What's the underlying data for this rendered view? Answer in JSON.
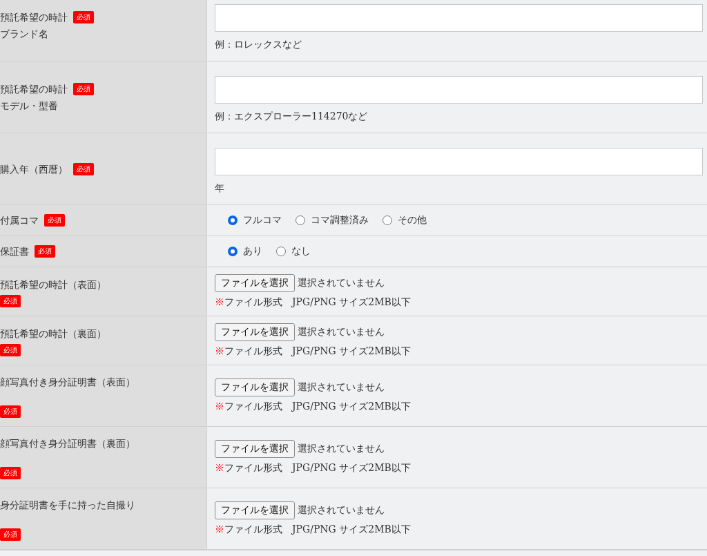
{
  "rows": [
    {
      "kind": "text",
      "label_lines": [
        "預託希望の時計",
        "ブランド名"
      ],
      "badge": "必須",
      "value": "",
      "hint": "例：ロレックスなど"
    },
    {
      "kind": "text",
      "label_lines": [
        "預託希望の時計",
        "モデル・型番"
      ],
      "badge": "必須",
      "value": "",
      "hint": "例：エクスプローラー114270など"
    },
    {
      "kind": "text",
      "label_lines": [
        "購入年（西暦）"
      ],
      "badge": "必須",
      "value": "",
      "hint": "年"
    },
    {
      "kind": "radio",
      "label_lines": [
        "付属コマ"
      ],
      "badge": "必須",
      "options": [
        {
          "label": "フルコマ",
          "selected": true
        },
        {
          "label": "コマ調整済み",
          "selected": false
        },
        {
          "label": "その他",
          "selected": false
        }
      ]
    },
    {
      "kind": "radio",
      "label_lines": [
        "保証書"
      ],
      "badge": "必須",
      "options": [
        {
          "label": "あり",
          "selected": true
        },
        {
          "label": "なし",
          "selected": false
        }
      ]
    },
    {
      "kind": "file",
      "label_lines": [
        "預託希望の時計（表面）"
      ],
      "badge": "必須",
      "button": "ファイルを選択",
      "status": "選択されていません",
      "note_mark": "※",
      "note": "ファイル形式　JPG/PNG サイズ2MB以下"
    },
    {
      "kind": "file",
      "label_lines": [
        "預託希望の時計（裏面）"
      ],
      "badge": "必須",
      "button": "ファイルを選択",
      "status": "選択されていません",
      "note_mark": "※",
      "note": "ファイル形式　JPG/PNG サイズ2MB以下"
    },
    {
      "kind": "document",
      "label_lines": [
        "顔写真付き身分証明書（表面）"
      ],
      "badge": "必須",
      "button": "ファイルを選択",
      "status": "選択されていません",
      "note_mark": "※",
      "note": "ファイル形式　JPG/PNG サイズ2MB以下"
    },
    {
      "kind": "document",
      "label_lines": [
        "顔写真付き身分証明書（裏面）"
      ],
      "badge": "必須",
      "button": "ファイルを選択",
      "status": "選択されていません",
      "note_mark": "※",
      "note": "ファイル形式　JPG/PNG サイズ2MB以下"
    },
    {
      "kind": "document",
      "label_lines": [
        "身分証明書を手に持った自撮り"
      ],
      "badge": "必須",
      "button": "ファイルを選択",
      "status": "選択されていません",
      "note_mark": "※",
      "note": "ファイル形式　JPG/PNG サイズ2MB以下"
    }
  ]
}
